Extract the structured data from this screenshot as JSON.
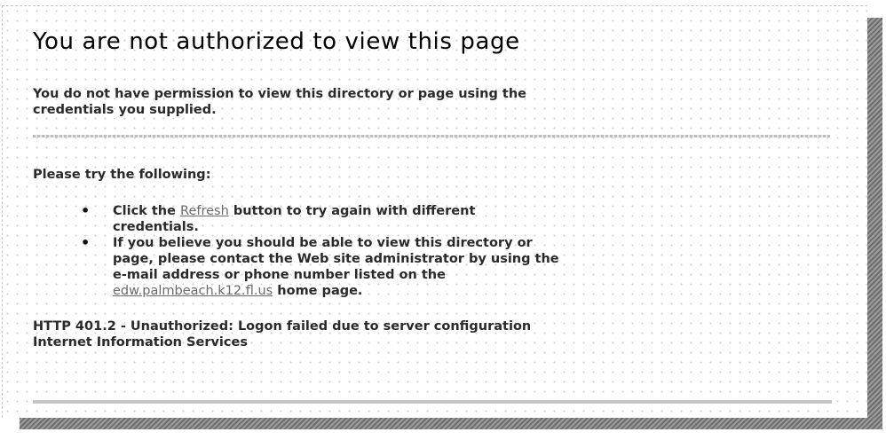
{
  "page": {
    "title": "You are not authorized to view this page",
    "lead_line1": "You do not have permission to view this directory or page using the",
    "lead_line2": "credentials you supplied.",
    "try_heading": "Please try the following:",
    "tips": [
      {
        "before": "Click the ",
        "link": "Refresh",
        "after_line1": " button to try again with different",
        "line2": "credentials."
      },
      {
        "line1": "If you believe you should be able to view this directory or",
        "line2": "page, please contact the Web site administrator by using the",
        "line3": "e-mail address or phone number listed on the",
        "link": "edw.palmbeach.k12.fl.us",
        "after": " home page."
      }
    ],
    "status_line1": "HTTP 401.2 - Unauthorized: Logon failed due to server configuration",
    "status_line2": "Internet Information Services",
    "bullet_glyph": "•"
  }
}
